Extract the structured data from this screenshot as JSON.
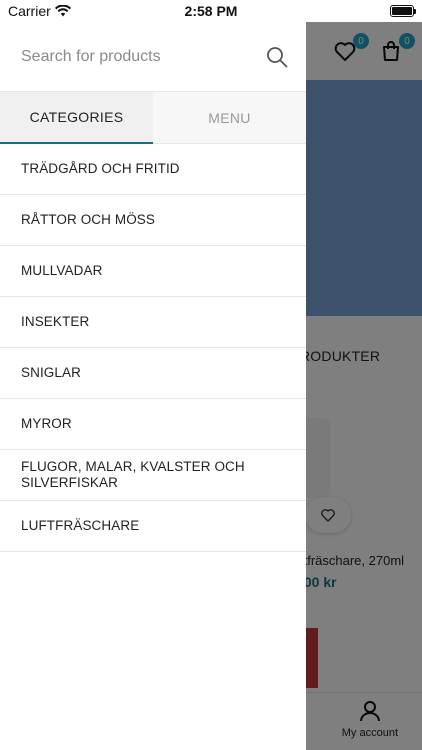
{
  "status_bar": {
    "carrier": "Carrier",
    "time": "2:58 PM"
  },
  "header": {
    "wishlist_count": "0",
    "cart_count": "0"
  },
  "background": {
    "section_title": "RODUKTER",
    "product_name": "ftfräschare, 270ml",
    "product_price": ",00 kr"
  },
  "tabbar": {
    "account_label": "My account"
  },
  "search": {
    "placeholder": "Search for products"
  },
  "drawer_tabs": {
    "categories": "CATEGORIES",
    "menu": "MENU"
  },
  "categories": [
    "TRÄDGÅRD OCH FRITID",
    "RÅTTOR OCH MÖSS",
    "MULLVADAR",
    "INSEKTER",
    "SNIGLAR",
    "MYROR",
    "FLUGOR, MALAR, KVALSTER OCH SILVERFISKAR",
    "LUFTFRÄSCHARE"
  ],
  "colors": {
    "accent": "#1a6f7c",
    "badge": "#1fa6c6"
  },
  "icons": [
    "wifi-icon",
    "battery-icon",
    "heart-icon",
    "shopping-bag-icon",
    "search-icon",
    "user-icon"
  ]
}
